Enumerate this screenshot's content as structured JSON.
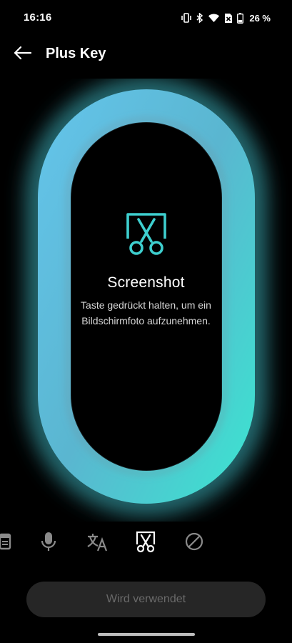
{
  "status_bar": {
    "time": "16:16",
    "battery_percent": "26 %",
    "icons": [
      "vibrate-icon",
      "bluetooth-icon",
      "wifi-icon",
      "sim-off-icon",
      "battery-icon"
    ]
  },
  "header": {
    "title": "Plus Key",
    "back_icon": "arrow-left-icon"
  },
  "feature": {
    "icon": "screenshot-scissors-icon",
    "title": "Screenshot",
    "description": "Taste gedrückt halten, um ein Bildschirmfoto aufzunehmen."
  },
  "options": [
    {
      "name": "partial-left-option",
      "icon": "unknown-partial-icon",
      "selected": false
    },
    {
      "name": "microphone-option",
      "icon": "microphone-icon",
      "selected": false
    },
    {
      "name": "translate-option",
      "icon": "translate-icon",
      "selected": false
    },
    {
      "name": "screenshot-option",
      "icon": "screenshot-scissors-icon",
      "selected": true
    },
    {
      "name": "none-option",
      "icon": "block-icon",
      "selected": false
    }
  ],
  "action_button": {
    "label": "Wird verwendet",
    "enabled": false
  },
  "colors": {
    "accent": "#3ecfcf",
    "ring_gradient_start": "#5fc6e6",
    "ring_gradient_end": "#42d8cf",
    "button_bg": "#262626",
    "button_text": "#6a6a6a"
  }
}
